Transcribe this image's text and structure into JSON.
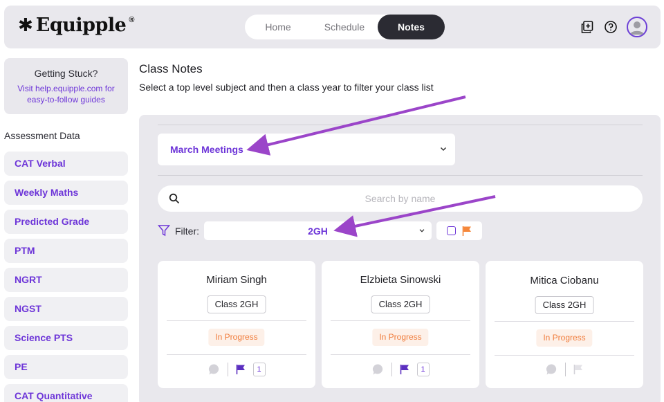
{
  "brand": {
    "logo_mark": "✱",
    "name": "Equipple",
    "reg": "®"
  },
  "nav": {
    "tabs": [
      {
        "label": "Home"
      },
      {
        "label": "Schedule"
      },
      {
        "label": "Notes",
        "active": true
      }
    ]
  },
  "header_icons": [
    "add-note-icon",
    "help-icon",
    "avatar"
  ],
  "help": {
    "title": "Getting Stuck?",
    "link": "Visit help.equipple.com for easy-to-follow guides"
  },
  "sidebar": {
    "heading": "Assessment Data",
    "items": [
      {
        "label": "CAT Verbal"
      },
      {
        "label": "Weekly Maths"
      },
      {
        "label": "Predicted Grade"
      },
      {
        "label": "PTM"
      },
      {
        "label": "NGRT"
      },
      {
        "label": "NGST"
      },
      {
        "label": "Science PTS"
      },
      {
        "label": "PE"
      },
      {
        "label": "CAT Quantitative"
      }
    ]
  },
  "main": {
    "title": "Class Notes",
    "subtitle": "Select a top level subject and then a class year to filter your class list",
    "meeting_select": "March Meetings",
    "search_placeholder": "Search by name",
    "filter_label": "Filter:",
    "filter_value": "2GH"
  },
  "cards": [
    {
      "name": "Miriam Singh",
      "class": "Class 2GH",
      "status": "In Progress",
      "flagged": true,
      "flag_count": "1"
    },
    {
      "name": "Elzbieta Sinowski",
      "class": "Class 2GH",
      "status": "In Progress",
      "flagged": true,
      "flag_count": "1"
    },
    {
      "name": "Mitica Ciobanu",
      "class": "Class 2GH",
      "status": "In Progress",
      "flagged": false
    }
  ],
  "colors": {
    "accent": "#6d35d8",
    "status": "#f07b3a",
    "flag_orange": "#f5873a",
    "annotation_arrow": "#9b45c9"
  }
}
